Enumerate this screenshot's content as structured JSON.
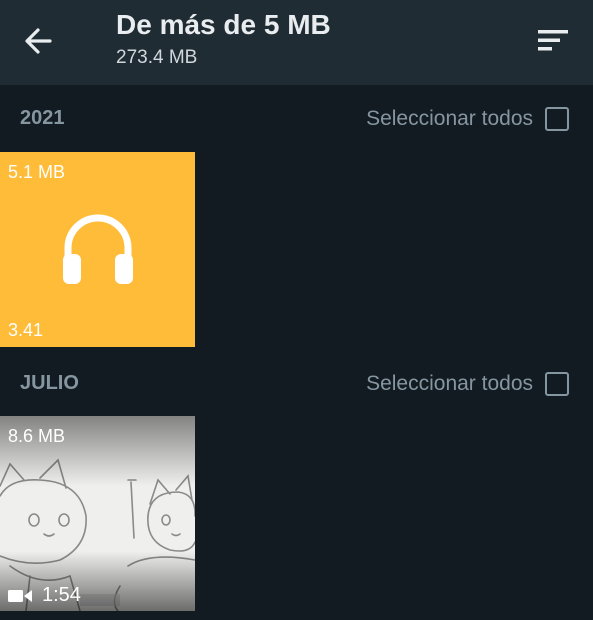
{
  "header": {
    "title": "De más de 5 MB",
    "subtitle": "273.4 MB",
    "back_icon": "arrow-left-icon",
    "sort_icon": "sort-icon"
  },
  "sections": [
    {
      "label": "2021",
      "select_all_label": "Seleccionar todos",
      "items": [
        {
          "kind": "audio",
          "size": "5.1 MB",
          "duration": "3.41",
          "icon": "headphones-icon",
          "color": "#ffbc38"
        }
      ]
    },
    {
      "label": "JULIO",
      "select_all_label": "Seleccionar todos",
      "items": [
        {
          "kind": "video",
          "size": "8.6 MB",
          "duration": "1:54",
          "icon": "video-camera-icon"
        }
      ]
    }
  ],
  "colors": {
    "background": "#121b22",
    "app_bar": "#1f2c34",
    "section_text": "#8696a0",
    "audio_tile": "#ffbc38"
  }
}
